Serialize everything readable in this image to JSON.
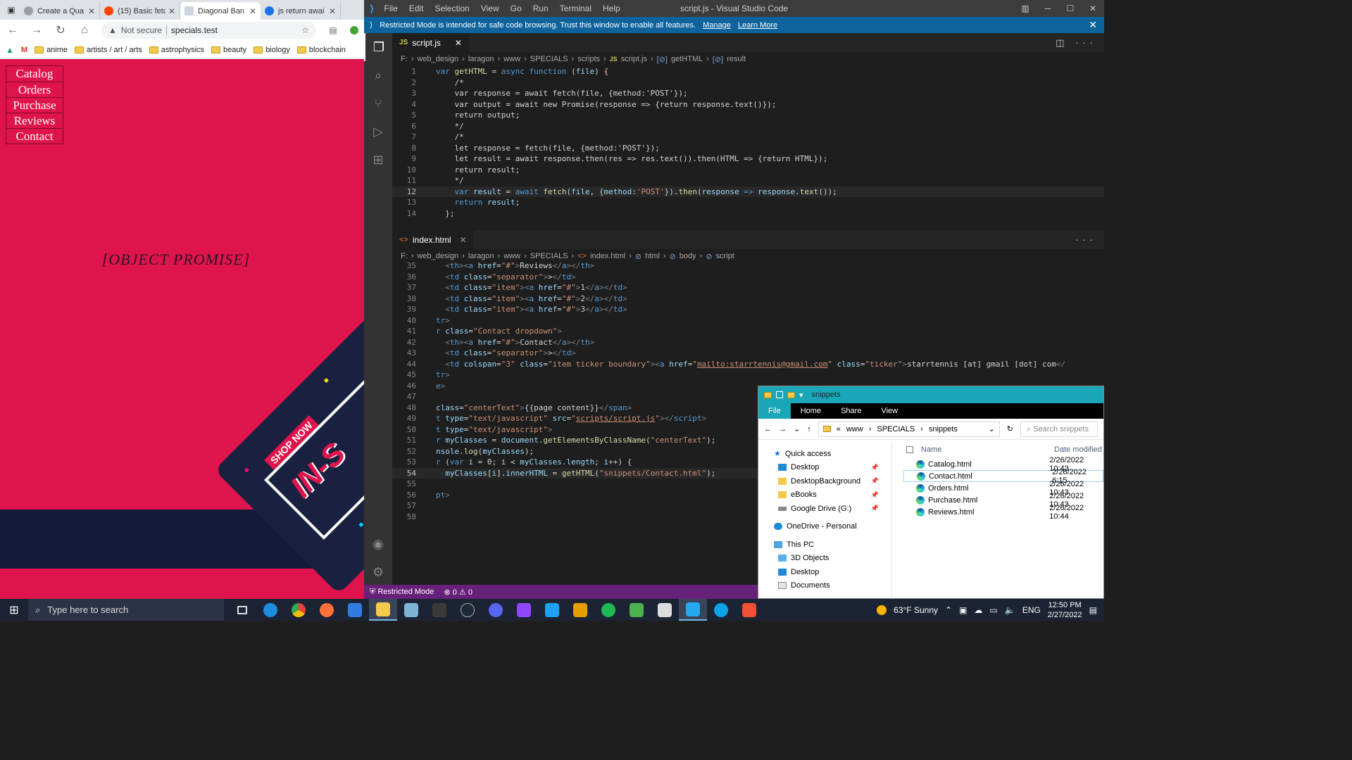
{
  "browser": {
    "tabs": [
      {
        "label": "Create a Qua",
        "color": "#9aa0a6"
      },
      {
        "label": "(15) Basic fetc",
        "color": "#ff4500"
      },
      {
        "label": "Diagonal Ban",
        "color": "#4a90d9",
        "active": true
      },
      {
        "label": "js return awai",
        "color": "#1a73e8"
      }
    ],
    "security": "Not secure",
    "url": "specials.test",
    "bookmarks": [
      "anime",
      "artists / art / arts",
      "astrophysics",
      "beauty",
      "biology",
      "blockchain"
    ],
    "site_nav": [
      "Catalog",
      "Orders",
      "Purchase",
      "Reviews",
      "Contact"
    ],
    "center_text": "[OBJECT PROMISE]",
    "banner": {
      "shop": "SHOP NOW",
      "big": "IN-S"
    }
  },
  "vscode": {
    "menu": [
      "File",
      "Edit",
      "Selection",
      "View",
      "Go",
      "Run",
      "Terminal",
      "Help"
    ],
    "window_title": "script.js - Visual Studio Code",
    "restricted_msg": "Restricted Mode is intended for safe code browsing. Trust this window to enable all features.",
    "manage": "Manage",
    "learn_more": "Learn More",
    "top_editor": {
      "tab": "script.js",
      "crumbs": [
        "F:",
        "web_design",
        "laragon",
        "www",
        "SPECIALS",
        "scripts",
        "script.js",
        "getHTML",
        "result"
      ]
    },
    "bottom_editor": {
      "tab": "index.html",
      "crumbs": [
        "F:",
        "web_design",
        "laragon",
        "www",
        "SPECIALS",
        "index.html",
        "html",
        "body",
        "script"
      ]
    },
    "status": {
      "mode": "Restricted Mode",
      "problems": "0",
      "warnings": "0"
    }
  },
  "explorer": {
    "title": "snippets",
    "ribbon": [
      "File",
      "Home",
      "Share",
      "View"
    ],
    "path": [
      "www",
      "SPECIALS",
      "snippets"
    ],
    "search_placeholder": "Search snippets",
    "nav": [
      {
        "label": "Quick access",
        "pin": false
      },
      {
        "label": "Desktop",
        "pin": true
      },
      {
        "label": "DesktopBackground",
        "pin": true
      },
      {
        "label": "eBooks",
        "pin": true
      },
      {
        "label": "Google Drive (G:)",
        "pin": true
      },
      {
        "label": "OneDrive - Personal",
        "pin": false
      },
      {
        "label": "This PC",
        "pin": false
      },
      {
        "label": "3D Objects",
        "pin": false
      },
      {
        "label": "Desktop",
        "pin": false
      },
      {
        "label": "Documents",
        "pin": false
      }
    ],
    "col_name": "Name",
    "col_date": "Date modified",
    "files": [
      {
        "name": "Catalog.html",
        "date": "2/26/2022 10:43"
      },
      {
        "name": "Contact.html",
        "date": "2/26/2022 6:15",
        "selected": true
      },
      {
        "name": "Orders.html",
        "date": "2/26/2022 10:43"
      },
      {
        "name": "Purchase.html",
        "date": "2/26/2022 10:43"
      },
      {
        "name": "Reviews.html",
        "date": "2/26/2022 10:44"
      }
    ]
  },
  "taskbar": {
    "search_placeholder": "Type here to search",
    "weather": "63°F  Sunny",
    "lang": "ENG",
    "time": "12:50 PM",
    "date": "2/27/2022"
  }
}
